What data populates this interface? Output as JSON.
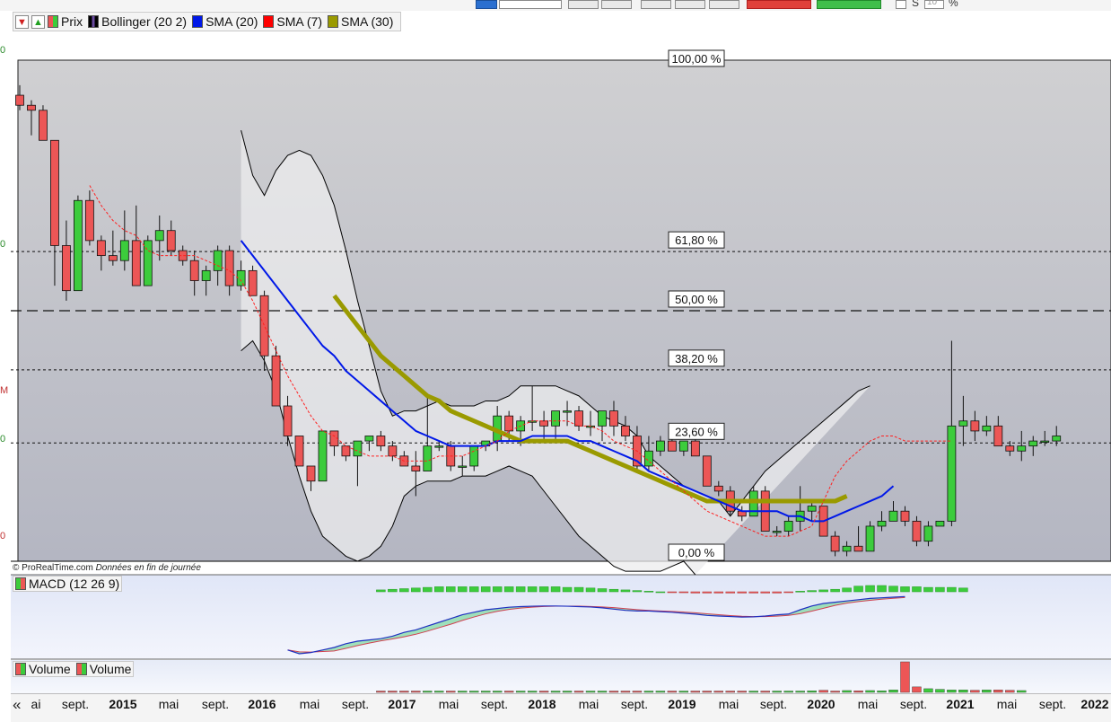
{
  "toolbar": {
    "percent_field_label": "%",
    "letter_s": "S",
    "number_field": "10"
  },
  "left_axis_labels": [
    "0",
    "0",
    "M",
    "0",
    "0",
    "0"
  ],
  "legend": {
    "items": [
      {
        "label": "Prix",
        "icon": "candle-icon",
        "color": "#4caf50"
      },
      {
        "label": "Bollinger (20 2)",
        "icon": "bollinger-icon",
        "color": "#000000"
      },
      {
        "label": "SMA (20)",
        "icon": "sma-icon",
        "color": "#0018e8"
      },
      {
        "label": "SMA (7)",
        "icon": "sma-icon",
        "color": "#ff0000"
      },
      {
        "label": "SMA (30)",
        "icon": "sma-icon",
        "color": "#9a9a00"
      }
    ]
  },
  "credit": {
    "site": "© ProRealTime.com",
    "note": "Données en fin de journée"
  },
  "macd_legend": "MACD (12 26 9)",
  "volume_legend": [
    "Volume",
    "Volume"
  ],
  "x_axis": {
    "ticks": [
      "ai",
      "sept.",
      "2015",
      "mai",
      "sept.",
      "2016",
      "mai",
      "sept.",
      "2017",
      "mai",
      "sept.",
      "2018",
      "mai",
      "sept.",
      "2019",
      "mai",
      "sept.",
      "2020",
      "mai",
      "sept.",
      "2021",
      "mai",
      "sept.",
      "2022"
    ],
    "year_ticks": [
      "2015",
      "2016",
      "2017",
      "2018",
      "2019",
      "2020",
      "2021",
      "2022"
    ]
  },
  "colors": {
    "up": "#3ccc3c",
    "down": "#ec5656",
    "sma20": "#0018e8",
    "sma7": "#ff2020",
    "sma30": "#9a9a00",
    "bollinger": "#000000",
    "macd_pos": "#3ccc3c",
    "macd_neg": "#ec5656"
  },
  "chart_data": {
    "type": "candlestick",
    "title": "",
    "xlabel": "",
    "ylabel": "",
    "period": "monthly",
    "x": [
      "2014-06",
      "2014-07",
      "2014-08",
      "2014-09",
      "2014-10",
      "2014-11",
      "2014-12",
      "2015-01",
      "2015-02",
      "2015-03",
      "2015-04",
      "2015-05",
      "2015-06",
      "2015-07",
      "2015-08",
      "2015-09",
      "2015-10",
      "2015-11",
      "2015-12",
      "2016-01",
      "2016-02",
      "2016-03",
      "2016-04",
      "2016-05",
      "2016-06",
      "2016-07",
      "2016-08",
      "2016-09",
      "2016-10",
      "2016-11",
      "2016-12",
      "2017-01",
      "2017-02",
      "2017-03",
      "2017-04",
      "2017-05",
      "2017-06",
      "2017-07",
      "2017-08",
      "2017-09",
      "2017-10",
      "2017-11",
      "2017-12",
      "2018-01",
      "2018-02",
      "2018-03",
      "2018-04",
      "2018-05",
      "2018-06",
      "2018-07",
      "2018-08",
      "2018-09",
      "2018-10",
      "2018-11",
      "2018-12",
      "2019-01",
      "2019-02",
      "2019-03",
      "2019-04",
      "2019-05",
      "2019-06",
      "2019-07",
      "2019-08",
      "2019-09",
      "2019-10",
      "2019-11",
      "2019-12",
      "2020-01",
      "2020-02",
      "2020-03",
      "2020-04",
      "2020-05",
      "2020-06",
      "2020-07",
      "2020-08",
      "2020-09",
      "2020-10",
      "2020-11",
      "2020-12",
      "2021-01",
      "2021-02",
      "2021-03",
      "2021-04",
      "2021-05",
      "2021-06",
      "2021-07",
      "2021-08",
      "2021-09",
      "2021-10",
      "2021-11"
    ],
    "ohlc": [
      [
        0.93,
        0.95,
        0.9,
        0.91
      ],
      [
        0.91,
        0.92,
        0.85,
        0.9
      ],
      [
        0.9,
        0.91,
        0.84,
        0.84
      ],
      [
        0.84,
        0.84,
        0.55,
        0.63
      ],
      [
        0.63,
        0.68,
        0.52,
        0.54
      ],
      [
        0.54,
        0.73,
        0.54,
        0.72
      ],
      [
        0.72,
        0.74,
        0.63,
        0.64
      ],
      [
        0.64,
        0.65,
        0.58,
        0.61
      ],
      [
        0.61,
        0.66,
        0.59,
        0.6
      ],
      [
        0.6,
        0.7,
        0.58,
        0.64
      ],
      [
        0.64,
        0.71,
        0.56,
        0.55
      ],
      [
        0.55,
        0.65,
        0.55,
        0.64
      ],
      [
        0.64,
        0.69,
        0.6,
        0.66
      ],
      [
        0.66,
        0.68,
        0.61,
        0.62
      ],
      [
        0.62,
        0.63,
        0.59,
        0.6
      ],
      [
        0.6,
        0.62,
        0.53,
        0.56
      ],
      [
        0.56,
        0.59,
        0.53,
        0.58
      ],
      [
        0.58,
        0.63,
        0.55,
        0.62
      ],
      [
        0.62,
        0.63,
        0.53,
        0.55
      ],
      [
        0.55,
        0.6,
        0.54,
        0.58
      ],
      [
        0.58,
        0.59,
        0.54,
        0.53
      ],
      [
        0.53,
        0.54,
        0.38,
        0.41
      ],
      [
        0.41,
        0.43,
        0.32,
        0.31
      ],
      [
        0.31,
        0.33,
        0.23,
        0.25
      ],
      [
        0.25,
        0.25,
        0.19,
        0.19
      ],
      [
        0.19,
        0.19,
        0.14,
        0.16
      ],
      [
        0.16,
        0.26,
        0.16,
        0.26
      ],
      [
        0.26,
        0.26,
        0.21,
        0.23
      ],
      [
        0.23,
        0.23,
        0.2,
        0.21
      ],
      [
        0.21,
        0.24,
        0.15,
        0.24
      ],
      [
        0.24,
        0.25,
        0.22,
        0.25
      ],
      [
        0.25,
        0.26,
        0.22,
        0.23
      ],
      [
        0.23,
        0.24,
        0.2,
        0.21
      ],
      [
        0.21,
        0.22,
        0.2,
        0.19
      ],
      [
        0.19,
        0.22,
        0.13,
        0.18
      ],
      [
        0.18,
        0.33,
        0.18,
        0.23
      ],
      [
        0.23,
        0.24,
        0.22,
        0.23
      ],
      [
        0.23,
        0.24,
        0.18,
        0.19
      ],
      [
        0.19,
        0.21,
        0.17,
        0.19
      ],
      [
        0.19,
        0.23,
        0.18,
        0.23
      ],
      [
        0.23,
        0.24,
        0.22,
        0.24
      ],
      [
        0.24,
        0.31,
        0.22,
        0.29
      ],
      [
        0.29,
        0.3,
        0.24,
        0.26
      ],
      [
        0.26,
        0.29,
        0.23,
        0.28
      ],
      [
        0.28,
        0.35,
        0.26,
        0.28
      ],
      [
        0.28,
        0.3,
        0.24,
        0.27
      ],
      [
        0.27,
        0.3,
        0.24,
        0.3
      ],
      [
        0.3,
        0.32,
        0.27,
        0.3
      ],
      [
        0.3,
        0.31,
        0.26,
        0.27
      ],
      [
        0.27,
        0.3,
        0.25,
        0.27
      ],
      [
        0.27,
        0.3,
        0.24,
        0.3
      ],
      [
        0.3,
        0.32,
        0.25,
        0.27
      ],
      [
        0.27,
        0.29,
        0.24,
        0.25
      ],
      [
        0.25,
        0.27,
        0.18,
        0.19
      ],
      [
        0.19,
        0.25,
        0.18,
        0.22
      ],
      [
        0.22,
        0.25,
        0.21,
        0.24
      ],
      [
        0.24,
        0.25,
        0.22,
        0.22
      ],
      [
        0.22,
        0.24,
        0.21,
        0.24
      ],
      [
        0.24,
        0.26,
        0.22,
        0.21
      ],
      [
        0.21,
        0.21,
        0.16,
        0.15
      ],
      [
        0.15,
        0.16,
        0.13,
        0.14
      ],
      [
        0.14,
        0.15,
        0.09,
        0.1
      ],
      [
        0.1,
        0.11,
        0.08,
        0.09
      ],
      [
        0.09,
        0.15,
        0.09,
        0.14
      ],
      [
        0.14,
        0.15,
        0.06,
        0.06
      ],
      [
        0.06,
        0.07,
        0.05,
        0.06
      ],
      [
        0.06,
        0.09,
        0.05,
        0.08
      ],
      [
        0.08,
        0.15,
        0.06,
        0.1
      ],
      [
        0.1,
        0.12,
        0.08,
        0.11
      ],
      [
        0.11,
        0.11,
        0.05,
        0.05
      ],
      [
        0.05,
        0.06,
        0.01,
        0.02
      ],
      [
        0.02,
        0.04,
        0.01,
        0.03
      ],
      [
        0.03,
        0.07,
        0.02,
        0.02
      ],
      [
        0.02,
        0.08,
        0.02,
        0.07
      ],
      [
        0.07,
        0.1,
        0.06,
        0.08
      ],
      [
        0.08,
        0.12,
        0.08,
        0.1
      ],
      [
        0.1,
        0.11,
        0.07,
        0.08
      ],
      [
        0.08,
        0.09,
        0.03,
        0.04
      ],
      [
        0.04,
        0.08,
        0.03,
        0.07
      ],
      [
        0.07,
        0.08,
        0.07,
        0.08
      ],
      [
        0.08,
        0.44,
        0.07,
        0.27
      ],
      [
        0.27,
        0.33,
        0.23,
        0.28
      ],
      [
        0.28,
        0.3,
        0.24,
        0.26
      ],
      [
        0.26,
        0.29,
        0.25,
        0.27
      ],
      [
        0.27,
        0.29,
        0.23,
        0.23
      ],
      [
        0.23,
        0.24,
        0.21,
        0.22
      ],
      [
        0.22,
        0.26,
        0.2,
        0.23
      ],
      [
        0.23,
        0.25,
        0.21,
        0.24
      ],
      [
        0.24,
        0.26,
        0.23,
        0.24
      ],
      [
        0.24,
        0.27,
        0.23,
        0.25
      ]
    ],
    "sma20": {
      "start": "2016-01",
      "values": [
        0.64,
        0.61,
        0.58,
        0.55,
        0.52,
        0.49,
        0.46,
        0.43,
        0.41,
        0.38,
        0.36,
        0.34,
        0.32,
        0.3,
        0.28,
        0.26,
        0.25,
        0.24,
        0.23,
        0.23,
        0.23,
        0.23,
        0.24,
        0.24,
        0.24,
        0.25,
        0.25,
        0.25,
        0.25,
        0.24,
        0.24,
        0.23,
        0.22,
        0.21,
        0.2,
        0.18,
        0.17,
        0.16,
        0.15,
        0.14,
        0.13,
        0.12,
        0.11,
        0.1,
        0.1,
        0.1,
        0.1,
        0.09,
        0.09,
        0.08,
        0.08,
        0.09,
        0.1,
        0.11,
        0.12,
        0.13,
        0.15
      ]
    },
    "sma7": {
      "start": "2014-12",
      "values": [
        0.75,
        0.71,
        0.68,
        0.66,
        0.65,
        0.62,
        0.61,
        0.61,
        0.61,
        0.61,
        0.6,
        0.59,
        0.58,
        0.56,
        0.52,
        0.47,
        0.42,
        0.37,
        0.33,
        0.29,
        0.26,
        0.25,
        0.23,
        0.22,
        0.21,
        0.21,
        0.21,
        0.2,
        0.2,
        0.2,
        0.21,
        0.21,
        0.21,
        0.22,
        0.23,
        0.24,
        0.26,
        0.27,
        0.28,
        0.28,
        0.28,
        0.28,
        0.27,
        0.27,
        0.26,
        0.24,
        0.23,
        0.22,
        0.2,
        0.18,
        0.16,
        0.14,
        0.12,
        0.1,
        0.09,
        0.08,
        0.07,
        0.06,
        0.05,
        0.05,
        0.05,
        0.06,
        0.07,
        0.12,
        0.17,
        0.2,
        0.22,
        0.24,
        0.25,
        0.25,
        0.24,
        0.24,
        0.24,
        0.24,
        0.24
      ]
    },
    "sma30": {
      "start": "2016-09",
      "values": [
        0.53,
        0.5,
        0.47,
        0.44,
        0.41,
        0.39,
        0.37,
        0.35,
        0.33,
        0.32,
        0.3,
        0.29,
        0.28,
        0.27,
        0.26,
        0.25,
        0.24,
        0.24,
        0.24,
        0.24,
        0.24,
        0.23,
        0.22,
        0.21,
        0.2,
        0.19,
        0.18,
        0.17,
        0.16,
        0.15,
        0.14,
        0.13,
        0.12,
        0.12,
        0.12,
        0.12,
        0.12,
        0.12,
        0.12,
        0.12,
        0.12,
        0.12,
        0.12,
        0.12,
        0.13
      ]
    },
    "bollinger_upper": {
      "start": "2016-01",
      "values": [
        0.86,
        0.77,
        0.73,
        0.78,
        0.81,
        0.82,
        0.81,
        0.77,
        0.71,
        0.62,
        0.52,
        0.43,
        0.34,
        0.29,
        0.3,
        0.3,
        0.31,
        0.32,
        0.31,
        0.31,
        0.31,
        0.32,
        0.32,
        0.33,
        0.35,
        0.35,
        0.35,
        0.35,
        0.34,
        0.33,
        0.31,
        0.29,
        0.28,
        0.27,
        0.25,
        0.21,
        0.19,
        0.17,
        0.15,
        0.14,
        0.13,
        0.12,
        0.09,
        0.12,
        0.15,
        0.18,
        0.2,
        0.22,
        0.24,
        0.26,
        0.28,
        0.3,
        0.32,
        0.34,
        0.35
      ]
    },
    "bollinger_lower": {
      "start": "2016-01",
      "values": [
        0.42,
        0.44,
        0.4,
        0.34,
        0.25,
        0.17,
        0.1,
        0.05,
        0.03,
        0.01,
        0.0,
        0.01,
        0.03,
        0.07,
        0.13,
        0.15,
        0.16,
        0.16,
        0.16,
        0.17,
        0.17,
        0.17,
        0.18,
        0.19,
        0.18,
        0.17,
        0.14,
        0.11,
        0.08,
        0.05,
        0.03,
        0.01,
        -0.01,
        -0.02,
        -0.02,
        -0.02,
        -0.02,
        -0.01,
        0.0,
        -0.05
      ]
    },
    "fibonacci_levels": [
      {
        "label": "100,00 %",
        "value": 1.0
      },
      {
        "label": "61,80 %",
        "value": 0.618
      },
      {
        "label": "50,00 %",
        "value": 0.5
      },
      {
        "label": "38,20 %",
        "value": 0.382
      },
      {
        "label": "23,60 %",
        "value": 0.236
      },
      {
        "label": "0,00 %",
        "value": 0.0
      }
    ],
    "macd_histogram": {
      "start": "2017-01",
      "values": [
        0.3,
        0.4,
        0.5,
        0.6,
        0.7,
        0.8,
        0.8,
        0.8,
        0.8,
        0.8,
        0.8,
        0.8,
        0.8,
        0.8,
        0.8,
        0.8,
        0.7,
        0.7,
        0.6,
        0.5,
        0.4,
        0.3,
        0.2,
        0.1,
        0.0,
        -0.1,
        -0.15,
        -0.2,
        -0.2,
        -0.2,
        -0.2,
        -0.2,
        -0.2,
        -0.2,
        -0.2,
        -0.1,
        0.1,
        0.2,
        0.3,
        0.4,
        0.6,
        0.9,
        1.0,
        1.0,
        0.9,
        0.8,
        0.8,
        0.7,
        0.7,
        0.7,
        0.6
      ]
    },
    "macd_line": {
      "start": "2016-05",
      "values": [
        -2.2,
        -2.5,
        -2.4,
        -2.2,
        -2.0,
        -1.7,
        -1.5,
        -1.4,
        -1.3,
        -1.1,
        -0.8,
        -0.6,
        -0.3,
        0.0,
        0.3,
        0.6,
        0.8,
        1.0,
        1.1,
        1.2,
        1.25,
        1.28,
        1.3,
        1.3,
        1.28,
        1.25,
        1.22,
        1.15,
        1.05,
        0.95,
        0.9,
        0.9,
        0.85,
        0.8,
        0.72,
        0.65,
        0.55,
        0.5,
        0.46,
        0.42,
        0.44,
        0.5,
        0.6,
        0.66,
        1.0,
        1.3,
        1.5,
        1.6,
        1.7,
        1.8,
        1.9,
        1.95,
        2.0,
        2.05
      ]
    },
    "volume": {
      "start": "2017-01",
      "values": [
        0.02,
        0.02,
        0.02,
        0.02,
        0.03,
        0.04,
        0.02,
        0.02,
        0.03,
        0.02,
        0.02,
        0.03,
        0.03,
        0.02,
        0.02,
        0.03,
        0.02,
        0.02,
        0.02,
        0.02,
        0.02,
        0.02,
        0.02,
        0.02,
        0.02,
        0.02,
        0.03,
        0.02,
        0.02,
        0.02,
        0.02,
        0.02,
        0.02,
        0.04,
        0.03,
        0.02,
        0.02,
        0.05,
        0.07,
        0.04,
        0.06,
        0.05,
        0.06,
        0.05,
        0.08,
        1.0,
        0.18,
        0.12,
        0.1,
        0.08,
        0.08,
        0.07,
        0.08,
        0.08,
        0.07,
        0.06
      ]
    }
  }
}
